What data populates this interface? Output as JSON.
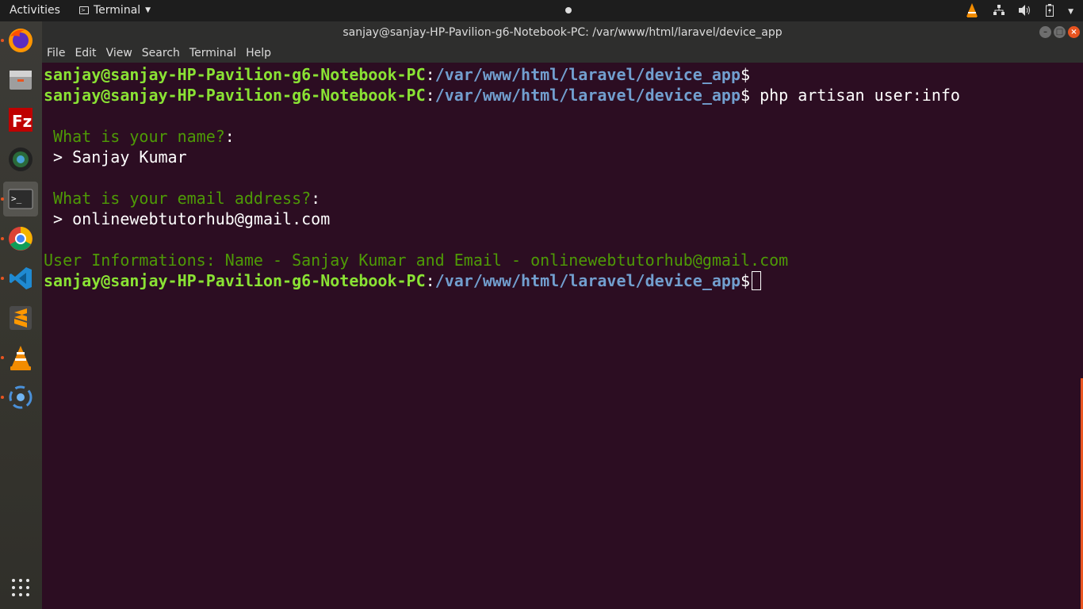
{
  "topbar": {
    "activities": "Activities",
    "app_menu": "Terminal",
    "tray_icons": [
      "vlc-icon",
      "network-icon",
      "volume-icon",
      "battery-icon",
      "system-menu-icon"
    ]
  },
  "dock": {
    "items": [
      {
        "name": "firefox",
        "running": true
      },
      {
        "name": "files",
        "running": false
      },
      {
        "name": "filezilla",
        "running": false
      },
      {
        "name": "camera",
        "running": false
      },
      {
        "name": "terminal",
        "running": true,
        "active": true
      },
      {
        "name": "chrome",
        "running": true
      },
      {
        "name": "vscode",
        "running": true
      },
      {
        "name": "sublime-text",
        "running": false
      },
      {
        "name": "vlc",
        "running": true
      },
      {
        "name": "app",
        "running": true
      }
    ],
    "show_apps": "show-applications-icon"
  },
  "window": {
    "title": "sanjay@sanjay-HP-Pavilion-g6-Notebook-PC: /var/www/html/laravel/device_app",
    "menu": [
      "File",
      "Edit",
      "View",
      "Search",
      "Terminal",
      "Help"
    ]
  },
  "terminal": {
    "user_host": "sanjay@sanjay-HP-Pavilion-g6-Notebook-PC",
    "colon": ":",
    "path": "/var/www/html/laravel/device_app",
    "dollar": "$",
    "command": " php artisan user:info",
    "q1": " What is your name?",
    "q1_colon": ":",
    "a1": " > Sanjay Kumar",
    "q2": " What is your email address?",
    "q2_colon": ":",
    "a2": " > onlinewebtutorhub@gmail.com",
    "result": "User Informations: Name - Sanjay Kumar and Email - onlinewebtutorhub@gmail.com"
  },
  "colors": {
    "terminal_bg": "#2c0d22",
    "prompt_user": "#8ae234",
    "prompt_path": "#729fcf",
    "question": "#4e9a06",
    "accent": "#e95420"
  }
}
